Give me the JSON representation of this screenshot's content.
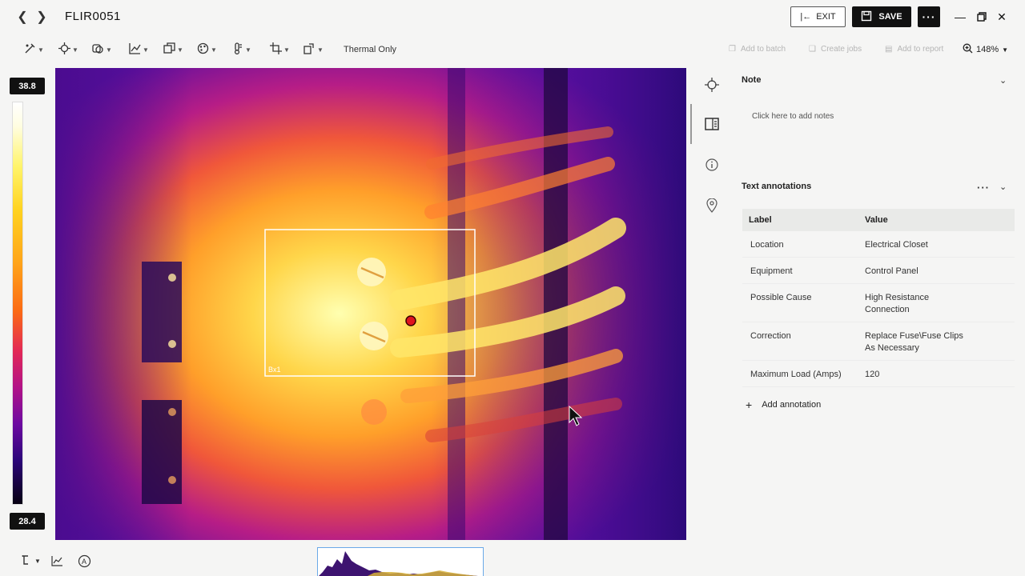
{
  "window": {
    "file_title": "FLIR0051",
    "exit_label": "EXIT",
    "save_label": "SAVE"
  },
  "toolbar": {
    "mode_label": "Thermal Only",
    "add_to_batch": "Add to batch",
    "create_jobs": "Create jobs",
    "add_to_report": "Add to report",
    "zoom": "148%"
  },
  "scale": {
    "max": "38.8",
    "min": "28.4"
  },
  "measurement": {
    "box_label": "Bx1"
  },
  "note": {
    "heading": "Note",
    "hint": "Click here to add notes"
  },
  "text_annotations": {
    "heading": "Text annotations",
    "col_label": "Label",
    "col_value": "Value",
    "rows": [
      {
        "label": "Location",
        "value": "Electrical Closet"
      },
      {
        "label": "Equipment",
        "value": "Control Panel"
      },
      {
        "label": "Possible Cause",
        "value": "High Resistance Connection"
      },
      {
        "label": "Correction",
        "value": "Replace Fuse\\Fuse Clips As Necessary"
      },
      {
        "label": "Maximum Load (Amps)",
        "value": "120"
      }
    ],
    "add_label": "Add annotation"
  },
  "colors": {
    "accent": "#111111",
    "histogram_border": "#6aa9e8"
  }
}
